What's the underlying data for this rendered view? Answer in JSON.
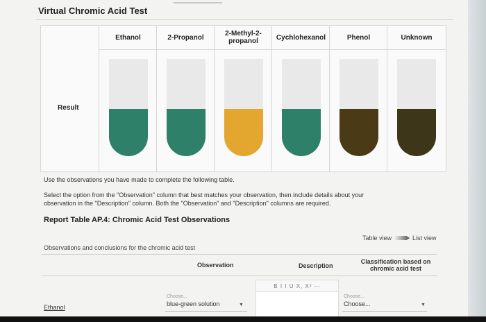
{
  "page": {
    "title": "Virtual Chromic Acid Test"
  },
  "results": {
    "row_label": "Result",
    "columns": [
      {
        "header": "Ethanol",
        "color": "#2e8068"
      },
      {
        "header": "2-Propanol",
        "color": "#2e8068"
      },
      {
        "header": "2-Methyl-2-\npropanol",
        "color": "#e3a62e"
      },
      {
        "header": "Cychlohexanol",
        "color": "#2e8068"
      },
      {
        "header": "Phenol",
        "color": "#4b3a16"
      },
      {
        "header": "Unknown",
        "color": "#3e3618"
      }
    ]
  },
  "instructions": {
    "line1": "Use the observations you have made to complete the following table.",
    "line2": "Select the option from the \"Observation\" column that best matches your observation, then include details about your",
    "line3": "observation in the \"Description\" column. Both the \"Observation\" and \"Description\" columns are required."
  },
  "report": {
    "title": "Report Table AP.4: Chromic Acid Test Observations",
    "view_table": "Table view",
    "view_list": "List view",
    "caption": "Observations and conclusions for the chromic acid test",
    "headers": {
      "observation": "Observation",
      "description": "Description",
      "classification": "Classification based on\nchromic acid test"
    },
    "editor_toolbar": "B I I U X, X² ⋯",
    "row": {
      "label": "Ethanol",
      "observation_hint": "Choose...",
      "observation_value": "blue-green solution",
      "classification_hint": "Choose...",
      "classification_value": "Choose..."
    }
  }
}
